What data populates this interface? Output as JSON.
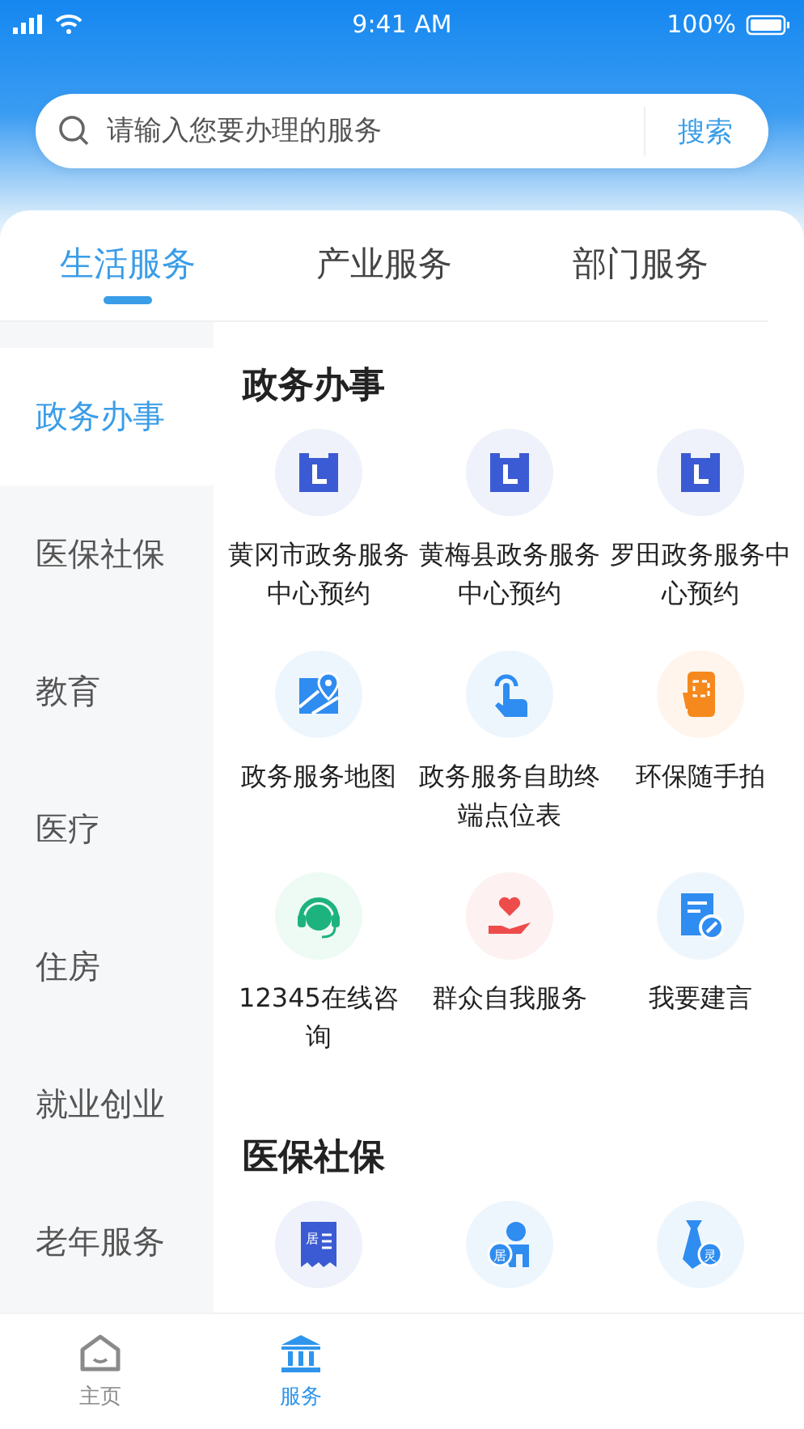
{
  "status_bar": {
    "time": "9:41 AM",
    "battery": "100%"
  },
  "search": {
    "placeholder": "请输入您要办理的服务",
    "button": "搜索"
  },
  "tabs": [
    {
      "label": "生活服务",
      "selected": true
    },
    {
      "label": "产业服务",
      "selected": false
    },
    {
      "label": "部门服务",
      "selected": false
    }
  ],
  "sidebar": {
    "items": [
      {
        "label": "政务办事",
        "selected": true
      },
      {
        "label": "医保社保",
        "selected": false
      },
      {
        "label": "教育",
        "selected": false
      },
      {
        "label": "医疗",
        "selected": false
      },
      {
        "label": "住房",
        "selected": false
      },
      {
        "label": "就业创业",
        "selected": false
      },
      {
        "label": "老年服务",
        "selected": false
      }
    ]
  },
  "sections": [
    {
      "title": "政务办事",
      "items": [
        {
          "kind": "calendar",
          "label": "黄冈市政务服务中心预约"
        },
        {
          "kind": "calendar",
          "label": "黄梅县政务服务中心预约"
        },
        {
          "kind": "calendar",
          "label": "罗田政务服务中心预约"
        },
        {
          "kind": "map",
          "label": "政务服务地图"
        },
        {
          "kind": "touch",
          "label": "政务服务自助终端点位表"
        },
        {
          "kind": "phone",
          "label": "环保随手拍"
        },
        {
          "kind": "headset",
          "label": "12345在线咨询"
        },
        {
          "kind": "heart",
          "label": "群众自我服务"
        },
        {
          "kind": "edit",
          "label": "我要建言"
        }
      ]
    },
    {
      "title": "医保社保",
      "items": [
        {
          "kind": "receipt",
          "badge": "居"
        },
        {
          "kind": "person",
          "badge": "居"
        },
        {
          "kind": "tie",
          "badge": "灵"
        }
      ]
    }
  ],
  "tab_bar": [
    {
      "label": "主页",
      "kind": "home",
      "selected": false
    },
    {
      "label": "服务",
      "kind": "bank",
      "selected": true
    }
  ]
}
